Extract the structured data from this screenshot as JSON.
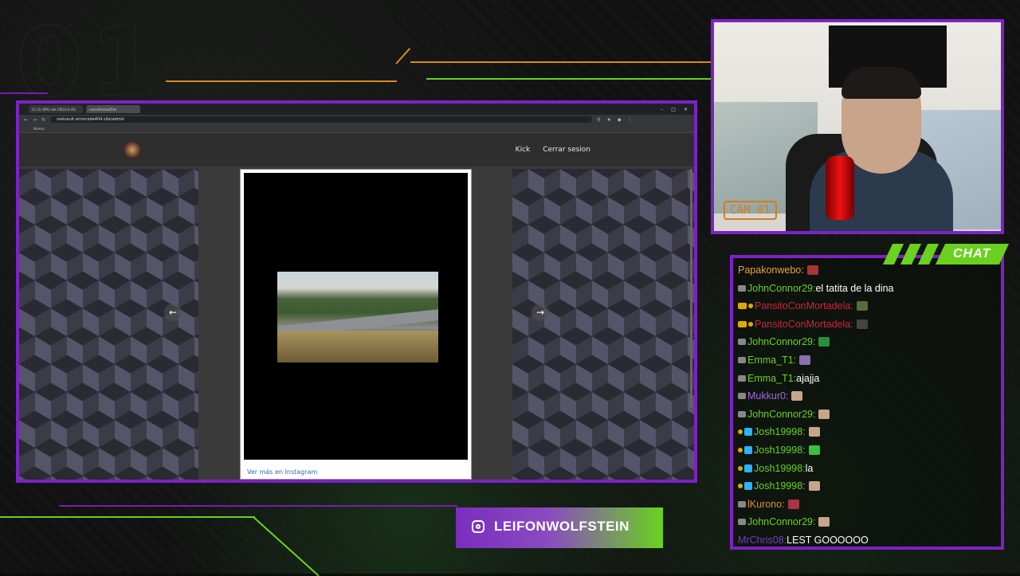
{
  "overlay": {
    "big_number": "01",
    "colors": {
      "frame": "#7d22c4",
      "accent_orange": "#d98a1f",
      "accent_green": "#6ad21e"
    }
  },
  "browser": {
    "tabs": [
      "(1) (1) BPG nds CRGS le OS",
      "rodr/olfeotw850n"
    ],
    "url": "realvault.errorcode404.site/admin",
    "bookmark": "Nomos",
    "site": {
      "nav": [
        "Kick",
        "Cerrar sesion"
      ],
      "modal_link": "Ver más en Instagram",
      "arrow_left": "←",
      "arrow_right": "→"
    }
  },
  "cam": {
    "label": "CAM 01"
  },
  "chat": {
    "title": "CHAT",
    "messages": [
      {
        "user": "Papakonwebo:",
        "text": "",
        "color": "#e8a23a",
        "badges": [],
        "emote": "#a33"
      },
      {
        "user": "JohnConnor29:",
        "text": "el tatita de la dina",
        "color": "#6ad21e",
        "badges": [
          "sword"
        ],
        "emote": ""
      },
      {
        "user": "PansitoConMortadela:",
        "text": "",
        "color": "#d0233a",
        "badges": [
          "crown",
          "dot"
        ],
        "emote": "#5a6b3a"
      },
      {
        "user": "PansitoConMortadela:",
        "text": "",
        "color": "#d0233a",
        "badges": [
          "crown",
          "dot"
        ],
        "emote": "#444"
      },
      {
        "user": "JohnConnor29:",
        "text": "",
        "color": "#6ad21e",
        "badges": [
          "sword"
        ],
        "emote": "#2a8f3a"
      },
      {
        "user": "Emma_T1:",
        "text": "",
        "color": "#6ad21e",
        "badges": [
          "sword"
        ],
        "emote": "#8a6fb0"
      },
      {
        "user": "Emma_T1:",
        "text": "ajajja",
        "color": "#6ad21e",
        "badges": [
          "sword"
        ],
        "emote": ""
      },
      {
        "user": "Mukkur0:",
        "text": "",
        "color": "#a46ae0",
        "badges": [
          "sword"
        ],
        "emote": "#c8a48a"
      },
      {
        "user": "JohnConnor29:",
        "text": "",
        "color": "#6ad21e",
        "badges": [
          "sword"
        ],
        "emote": "#c8a48a"
      },
      {
        "user": "Josh19998:",
        "text": "",
        "color": "#6ad21e",
        "badges": [
          "dot",
          "gift"
        ],
        "emote": "#c8a48a"
      },
      {
        "user": "Josh19998:",
        "text": "",
        "color": "#6ad21e",
        "badges": [
          "dot",
          "gift"
        ],
        "emote": "#3ac23a"
      },
      {
        "user": "Josh19998:",
        "text": "la",
        "color": "#6ad21e",
        "badges": [
          "dot",
          "gift"
        ],
        "emote": ""
      },
      {
        "user": "Josh19998:",
        "text": "",
        "color": "#6ad21e",
        "badges": [
          "dot",
          "gift"
        ],
        "emote": "#c8a48a"
      },
      {
        "user": "lKurono:",
        "text": "",
        "color": "#d9932a",
        "badges": [
          "sword"
        ],
        "emote": "#a34"
      },
      {
        "user": "JohnConnor29:",
        "text": "",
        "color": "#6ad21e",
        "badges": [
          "sword"
        ],
        "emote": "#c8a48a"
      },
      {
        "user": "MrChris08:",
        "text": "LEST GOOOOOO",
        "color": "#7a3cc9",
        "badges": [],
        "emote": ""
      }
    ]
  },
  "social": {
    "handle": "LEIFONWOLFSTEIN",
    "icon": "instagram-icon"
  }
}
